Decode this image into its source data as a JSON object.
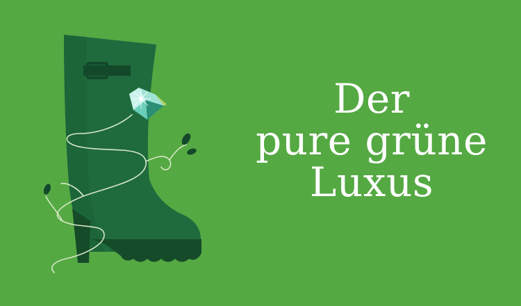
{
  "headline": {
    "line1": "Der",
    "line2": "pure grüne",
    "line3": "Luxus"
  },
  "colors": {
    "background": "#55a943",
    "boot": "#1f6b3d",
    "boot_shadow": "#18562f",
    "sole": "#154b29",
    "vine": "#d7e8c5",
    "leaf": "#14482a",
    "gem_light": "#c9f2ec",
    "gem_mid": "#6ccfb9",
    "gem_dark": "#2a8f74",
    "text": "#ffffff"
  },
  "icons": {
    "boot": "rubber-boot-icon",
    "gem": "diamond-icon",
    "vine": "vine-icon"
  }
}
